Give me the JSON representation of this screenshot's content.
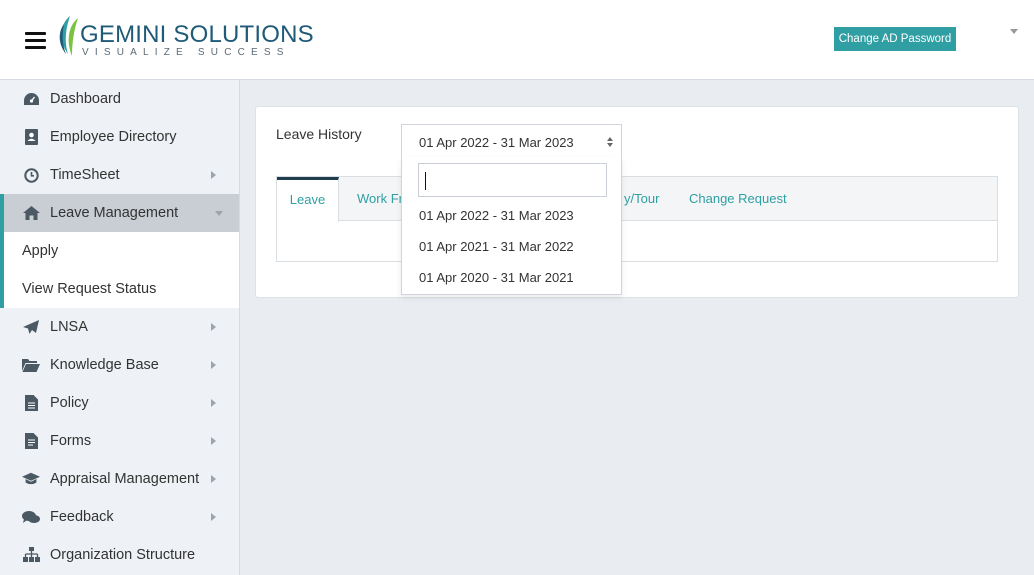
{
  "header": {
    "logo_name": "GEMINI SOLUTIONS",
    "logo_tagline": "VISUALIZE SUCCESS",
    "change_password_label": "Change AD Password"
  },
  "sidebar": {
    "items": [
      {
        "label": "Dashboard",
        "icon": "dashboard-icon"
      },
      {
        "label": "Employee Directory",
        "icon": "address-book-icon"
      },
      {
        "label": "TimeSheet",
        "icon": "clock-icon"
      },
      {
        "label": "Leave Management",
        "icon": "home-icon"
      },
      {
        "label": "LNSA",
        "icon": "paper-plane-icon"
      },
      {
        "label": "Knowledge Base",
        "icon": "folder-open-icon"
      },
      {
        "label": "Policy",
        "icon": "document-icon"
      },
      {
        "label": "Forms",
        "icon": "form-icon"
      },
      {
        "label": "Appraisal Management",
        "icon": "graduation-cap-icon"
      },
      {
        "label": "Feedback",
        "icon": "comments-icon"
      },
      {
        "label": "Organization Structure",
        "icon": "sitemap-icon"
      }
    ],
    "sub_items": [
      {
        "label": "Apply"
      },
      {
        "label": "View Request Status"
      }
    ]
  },
  "main": {
    "leave_history_label": "Leave History",
    "selected_period": "01 Apr 2022 - 31 Mar 2023",
    "search_value": "",
    "period_options": [
      "01 Apr 2022 - 31 Mar 2023",
      "01 Apr 2021 - 31 Mar 2022",
      "01 Apr 2020 - 31 Mar 2021"
    ],
    "tabs": [
      {
        "label": "Leave"
      },
      {
        "label": "Work Fr"
      },
      {
        "label": "y/Tour"
      },
      {
        "label": "Change Request"
      }
    ]
  },
  "colors": {
    "accent": "#2f9fa3",
    "active_tab_border": "#1f3d4c",
    "sidebar_active_bg": "#c8ced4"
  }
}
